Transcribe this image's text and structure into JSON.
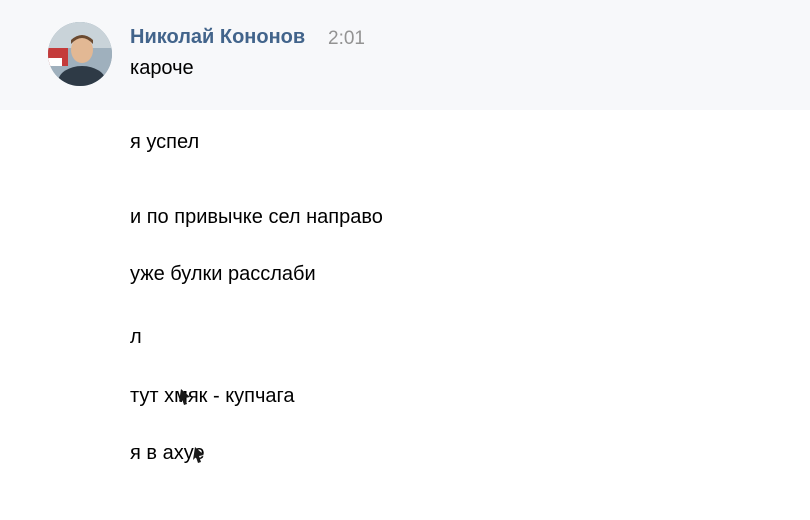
{
  "message": {
    "author": "Николай Кононов",
    "time": "2:01",
    "lines": [
      "кароче",
      "я успел",
      "и по привычке сел направо",
      "уже булки расслаби",
      "л",
      "тут хмяк - купчага",
      "я в ахуе"
    ]
  },
  "icons": {
    "avatar": "user-photo",
    "overlay_marks": "cursor-artifact"
  }
}
